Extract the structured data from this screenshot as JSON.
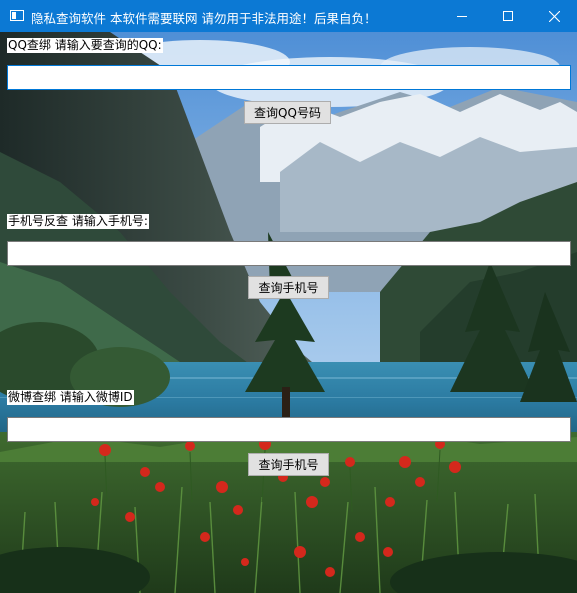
{
  "window": {
    "title": "隐私查询软件 本软件需要联网 请勿用于非法用途！后果自负！"
  },
  "qq_section": {
    "label": "QQ查绑 请输入要查询的QQ:",
    "input_value": "",
    "button_label": "查询QQ号码"
  },
  "phone_section": {
    "label": "手机号反查 请输入手机号:",
    "input_value": "",
    "button_label": "查询手机号"
  },
  "weibo_section": {
    "label": "微博查绑 请输入微博ID",
    "input_value": "",
    "button_label": "查询手机号"
  },
  "icons": {
    "app": "window-app-icon",
    "minimize": "minimize-icon",
    "maximize": "maximize-icon",
    "close": "close-icon"
  },
  "colors": {
    "titlebar": "#0c79d4",
    "button_face": "#e1e1e1",
    "input_focus_border": "#0078d7"
  }
}
